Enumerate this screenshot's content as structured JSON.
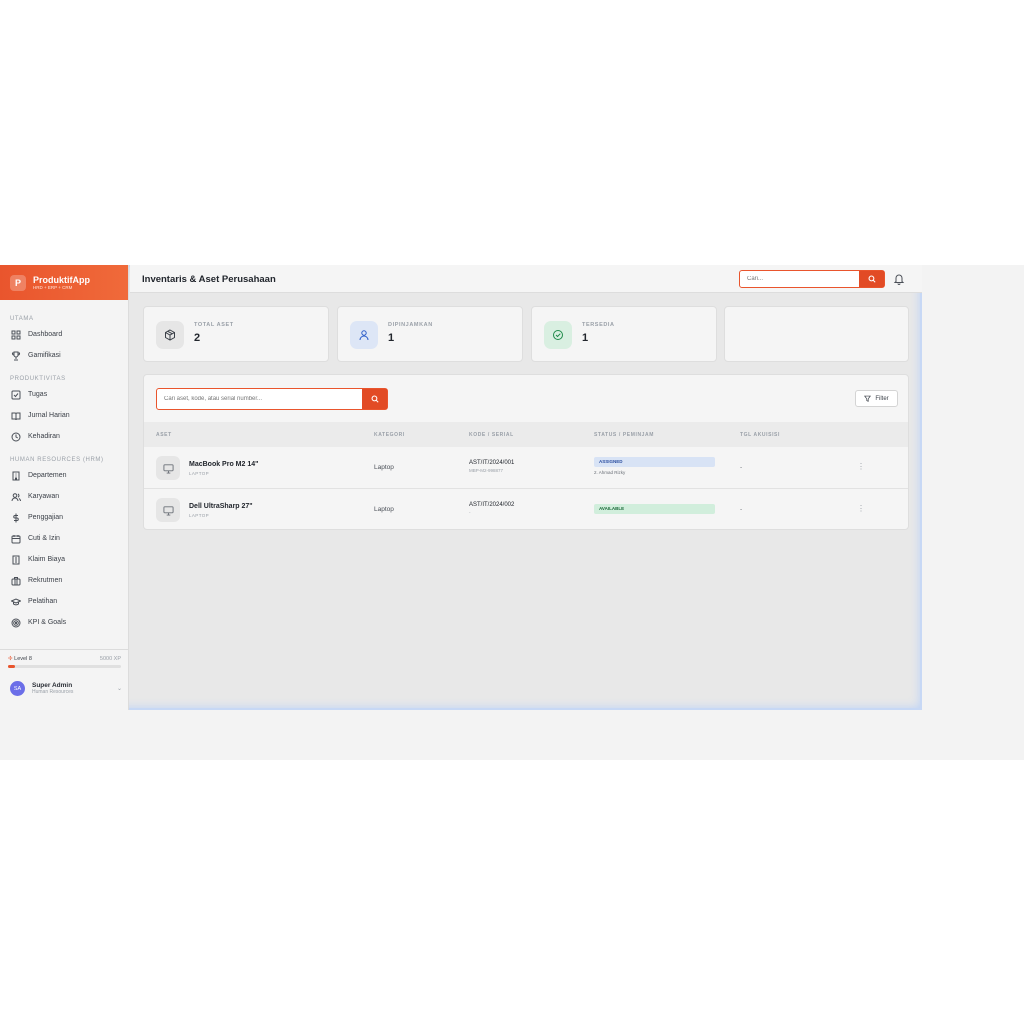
{
  "brand": {
    "logo": "P",
    "name": "ProduktifApp",
    "subtitle": "HRD + ERP + CRM"
  },
  "sidebar": {
    "sections": [
      {
        "title": "UTAMA",
        "items": [
          {
            "label": "Dashboard",
            "icon": "grid-icon"
          },
          {
            "label": "Gamifikasi",
            "icon": "trophy-icon"
          }
        ]
      },
      {
        "title": "PRODUKTIVITAS",
        "items": [
          {
            "label": "Tugas",
            "icon": "checkbox-icon"
          },
          {
            "label": "Jurnal Harian",
            "icon": "book-icon"
          },
          {
            "label": "Kehadiran",
            "icon": "clock-icon"
          }
        ]
      },
      {
        "title": "HUMAN RESOURCES (HRM)",
        "items": [
          {
            "label": "Departemen",
            "icon": "building-icon"
          },
          {
            "label": "Karyawan",
            "icon": "users-icon"
          },
          {
            "label": "Penggajian",
            "icon": "dollar-icon"
          },
          {
            "label": "Cuti & Izin",
            "icon": "calendar-icon"
          },
          {
            "label": "Klaim Biaya",
            "icon": "receipt-icon"
          },
          {
            "label": "Rekrutmen",
            "icon": "briefcase-icon"
          },
          {
            "label": "Pelatihan",
            "icon": "graduation-cap-icon"
          },
          {
            "label": "KPI & Goals",
            "icon": "target-icon"
          }
        ]
      }
    ],
    "level": {
      "label": "Level 8",
      "xp": "5000 XP",
      "progress": 0.06
    },
    "user": {
      "initials": "SA",
      "name": "Super Admin",
      "role": "Human Resources"
    }
  },
  "header": {
    "title": "Inventaris & Aset Perusahaan",
    "search_placeholder": "Cari..."
  },
  "stats": [
    {
      "label": "TOTAL ASET",
      "value": "2",
      "icon": "box-icon",
      "icon_bg": "#e6e6e6",
      "icon_color": "#3a3f47"
    },
    {
      "label": "DIPINJAMKAN",
      "value": "1",
      "icon": "user-icon",
      "icon_bg": "#dde6f6",
      "icon_color": "#2b5cc9"
    },
    {
      "label": "TERSEDIA",
      "value": "1",
      "icon": "check-circle-icon",
      "icon_bg": "#d9efe1",
      "icon_color": "#1f8a4a"
    }
  ],
  "table": {
    "search_placeholder": "Cari aset, kode, atau serial number...",
    "filter_label": "Filter",
    "columns": [
      "ASET",
      "KATEGORI",
      "KODE / SERIAL",
      "STATUS / PEMINJAM",
      "TGL AKUISISI"
    ],
    "rows": [
      {
        "name": "MacBook Pro M2 14\"",
        "type": "LAPTOP",
        "category": "Laptop",
        "code": "AST/IT/2024/001",
        "serial": "MBP-M2-998877",
        "status": "ASSIGNED",
        "status_kind": "assigned",
        "borrower": "2. Ahmad Rizky",
        "date": "-",
        "more": "⋮"
      },
      {
        "name": "Dell UltraSharp 27\"",
        "type": "LAPTOP",
        "category": "Laptop",
        "code": "AST/IT/2024/002",
        "serial": "-",
        "status": "AVAILABLE",
        "status_kind": "available",
        "borrower": "",
        "date": "-",
        "more": "⋮"
      }
    ]
  },
  "colors": {
    "brand": "#e9552d",
    "accent_blue": "#2b5cc9",
    "success": "#1f8a4a"
  }
}
